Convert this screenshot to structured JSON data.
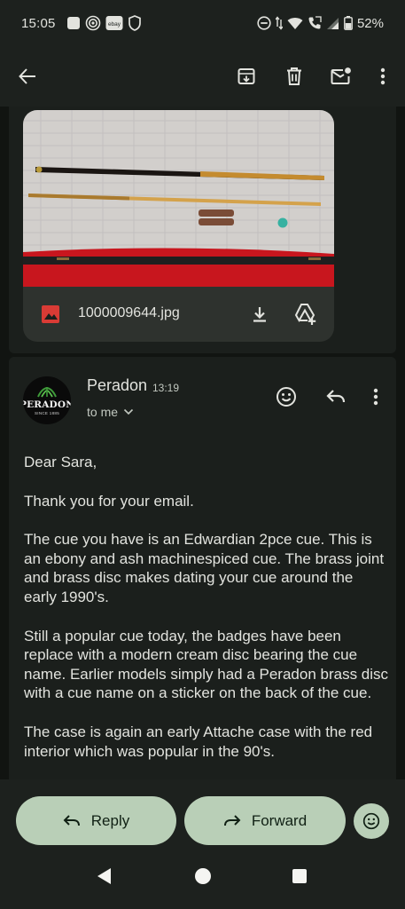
{
  "status_bar": {
    "time": "15:05",
    "left_icons": [
      "notification-square-icon",
      "at-sign-icon",
      "ebay-icon",
      "shield-icon"
    ],
    "ebay_label": "ebay",
    "right_icons": [
      "do-not-disturb-icon",
      "data-arrows-icon",
      "wifi-icon",
      "call-icon",
      "signal-icon",
      "battery-icon"
    ],
    "battery": "52%"
  },
  "app_bar": {
    "icons": [
      "back-arrow-icon",
      "archive-icon",
      "delete-icon",
      "mark-unread-icon",
      "more-vert-icon"
    ]
  },
  "attachment": {
    "file_name": "1000009644.jpg",
    "type_icon": "image-icon",
    "actions": [
      "download-icon",
      "add-to-drive-icon"
    ]
  },
  "message": {
    "avatar": {
      "brand": "PERADON",
      "since": "SINCE 1885"
    },
    "sender": "Peradon",
    "time": "13:19",
    "recipient": "to me",
    "greeting": "Dear Sara,",
    "paragraphs": [
      "Thank you for your email.",
      "The cue you have is an Edwardian 2pce cue. This is an ebony and ash machinespiced cue. The brass joint and brass disc makes dating your cue around the early 1990's.",
      "Still a popular cue today, the badges have been replace with a modern cream disc bearing the cue name. Earlier models simply had a Peradon brass disc with a cue name on a sticker on the back of the cue.",
      "The case is again an early Attache case with the red interior which was popular in the 90's."
    ]
  },
  "bottom_actions": {
    "reply": "Reply",
    "forward": "Forward"
  },
  "colors": {
    "background": "#191c19",
    "card": "#1b1f1c",
    "pill": "#b9cfb7",
    "text": "#e2e3de",
    "accent_red": "#d93b35"
  }
}
